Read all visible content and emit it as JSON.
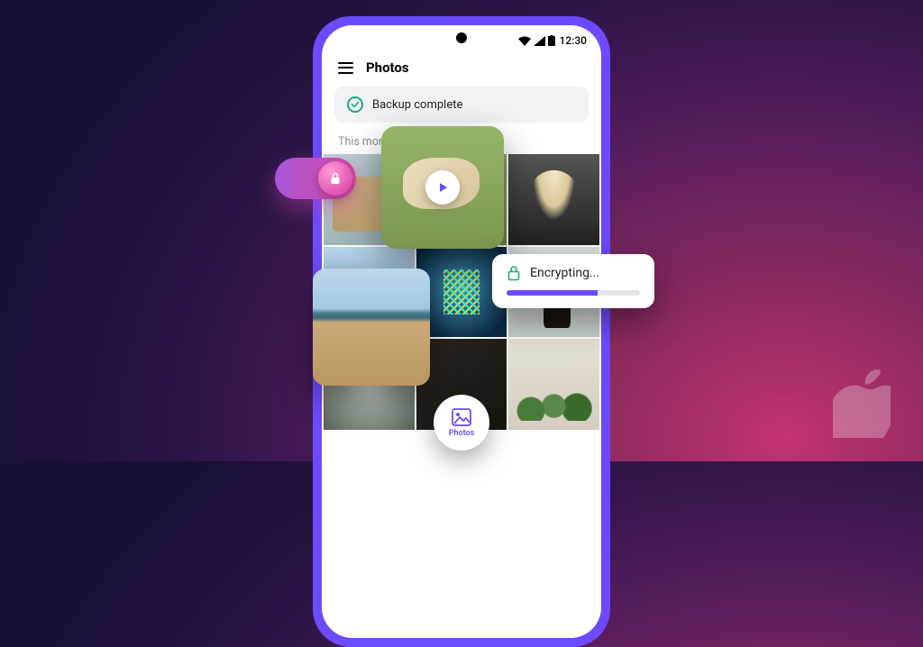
{
  "status_bar": {
    "time": "12:30"
  },
  "app": {
    "title": "Photos",
    "banner_text": "Backup complete",
    "section_label": "This month"
  },
  "encrypting": {
    "label": "Encrypting..."
  },
  "fab": {
    "label": "Photos"
  },
  "colors": {
    "accent": "#6d4aff",
    "success": "#1ea885"
  }
}
